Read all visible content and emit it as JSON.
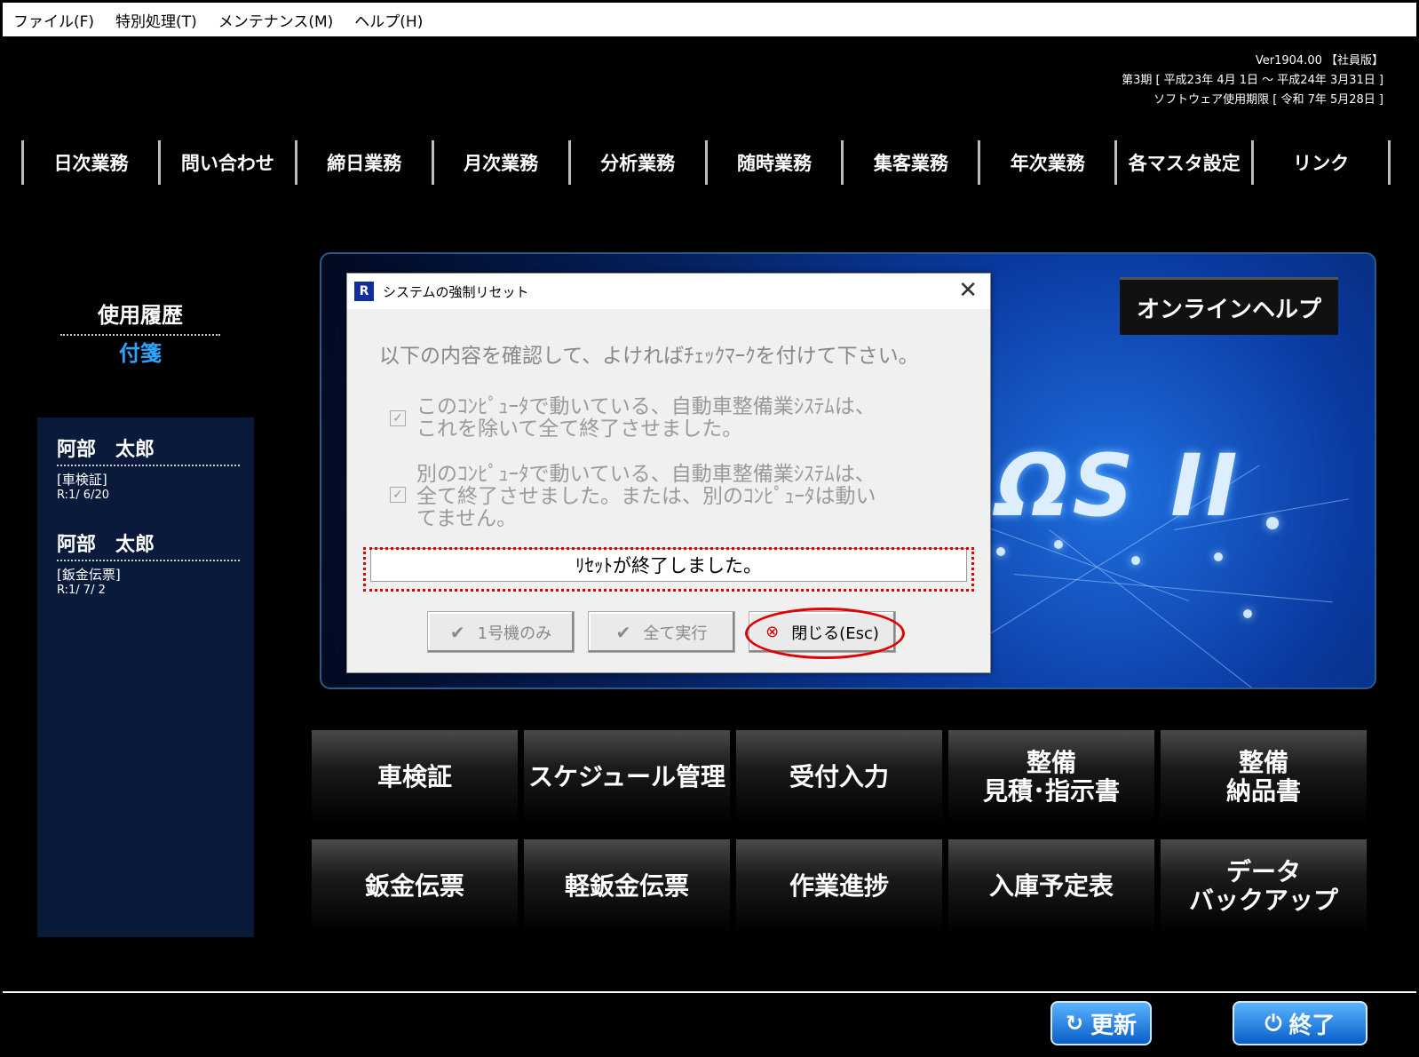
{
  "menubar": [
    "ファイル(F)",
    "特別処理(T)",
    "メンテナンス(M)",
    "ヘルプ(H)"
  ],
  "version": {
    "line1": "Ver1904.00 【社員版】",
    "line2": "第3期 [ 平成23年 4月 1日 ～ 平成24年 3月31日 ]",
    "line3": "ソフトウェア使用期限 [ 令和 7年 5月28日 ]"
  },
  "nav": [
    "日次業務",
    "問い合わせ",
    "締日業務",
    "月次業務",
    "分析業務",
    "随時業務",
    "集客業務",
    "年次業務",
    "各マスタ設定",
    "リンク"
  ],
  "history": {
    "title": "使用履歴",
    "tag": "付箋",
    "entries": [
      {
        "name": "阿部　太郎",
        "type": "[車検証]",
        "date": "R:1/ 6/20"
      },
      {
        "name": "阿部　太郎",
        "type": "[鈑金伝票]",
        "date": "R:1/ 7/ 2"
      }
    ]
  },
  "hero": {
    "logo": "ΩS II"
  },
  "online_help": "オンラインヘルプ",
  "dialog": {
    "icon": "R",
    "title": "システムの強制リセット",
    "close": "✕",
    "instruction": "以下の内容を確認して、よければﾁｪｯｸﾏｰｸを付けて下さい。",
    "check1_line1": "このｺﾝﾋﾟｭｰﾀで動いている、自動車整備業ｼｽﾃﾑは、",
    "check1_line2": "これを除いて全て終了させました。",
    "check2_line1": "別のｺﾝﾋﾟｭｰﾀで動いている、自動車整備業ｼｽﾃﾑは、",
    "check2_line2": "全て終了させました。または、別のｺﾝﾋﾟｭｰﾀは動い",
    "check2_line3": "てません。",
    "check_mark": "✓",
    "message": "ﾘｾｯﾄが終了しました。",
    "btn1": "1号機のみ",
    "btn2": "全て実行",
    "btn3": "閉じる(Esc)",
    "btn_check_icon": "✔",
    "btn_close_icon": "⊗"
  },
  "tiles": {
    "row1": [
      {
        "l1": "車検証",
        "l2": ""
      },
      {
        "l1": "スケジュール管理",
        "l2": ""
      },
      {
        "l1": "受付入力",
        "l2": ""
      },
      {
        "l1": "整備",
        "l2": "見積･指示書"
      },
      {
        "l1": "整備",
        "l2": "納品書"
      }
    ],
    "row2": [
      {
        "l1": "鈑金伝票",
        "l2": ""
      },
      {
        "l1": "軽鈑金伝票",
        "l2": ""
      },
      {
        "l1": "作業進捗",
        "l2": ""
      },
      {
        "l1": "入庫予定表",
        "l2": ""
      },
      {
        "l1": "データ",
        "l2": "バックアップ"
      }
    ]
  },
  "footer": {
    "refresh": "更新",
    "refresh_icon": "↻",
    "exit": "終了",
    "exit_icon": "⏻"
  }
}
